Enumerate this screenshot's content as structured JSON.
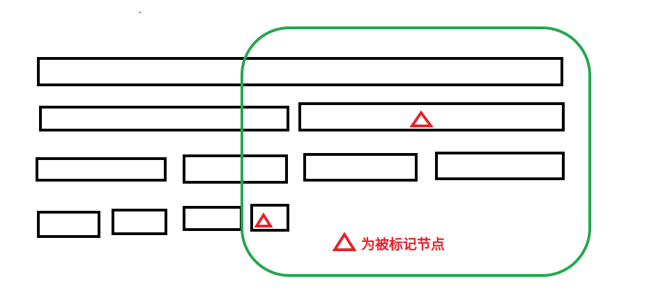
{
  "legend": {
    "text": "为被标记节点"
  },
  "colors": {
    "node_stroke": "#000000",
    "region_stroke": "#22a84a",
    "marker": "#e8202a"
  },
  "icons": {
    "marker": "triangle-outline-icon"
  }
}
